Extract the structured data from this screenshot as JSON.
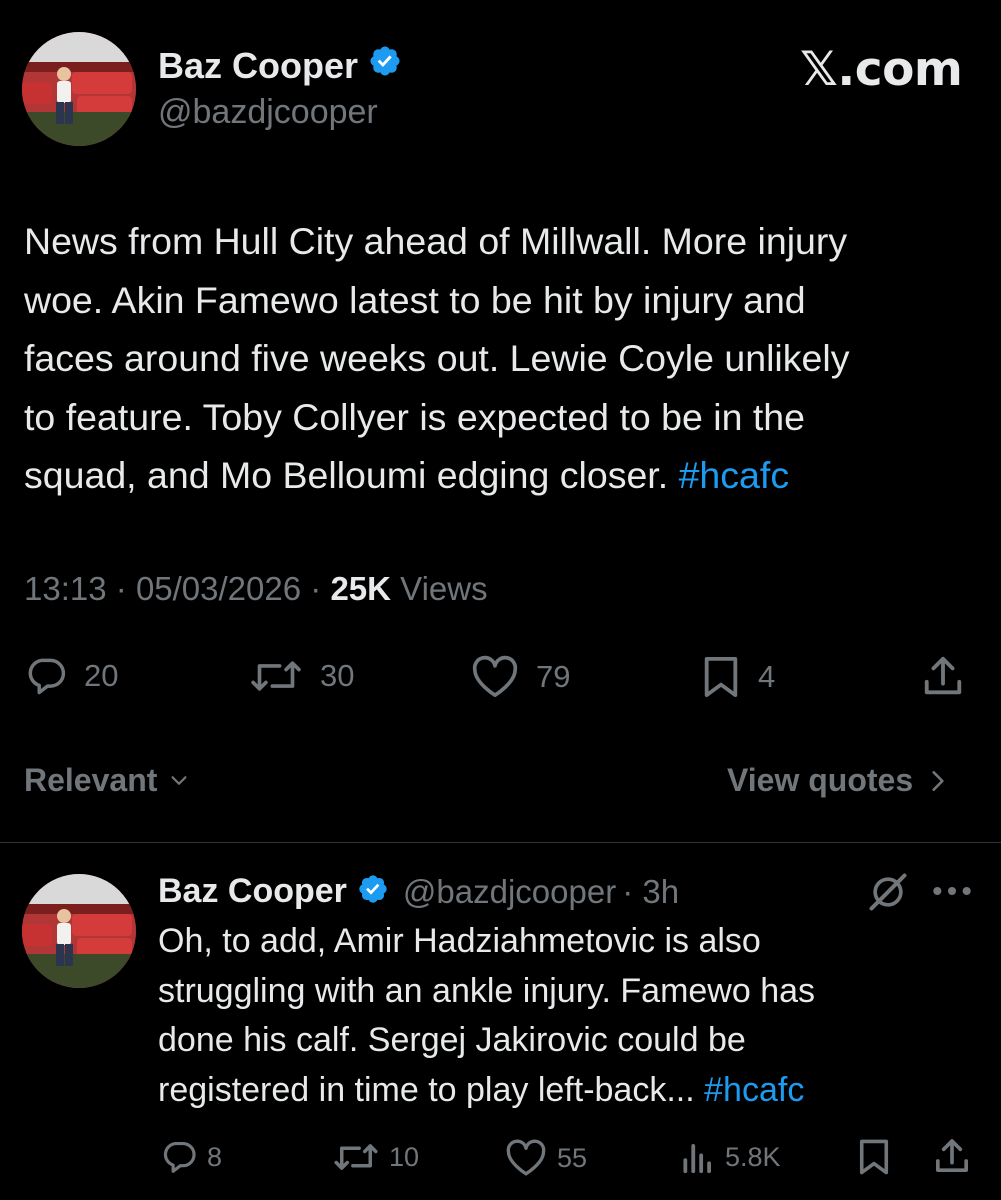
{
  "brand": "𝕏.com",
  "main_tweet": {
    "author_name": "Baz Cooper",
    "handle": "@bazdjcooper",
    "text_lines": [
      "News from Hull City ahead of Millwall. More injury",
      "woe. Akin Famewo latest to be hit by injury and",
      "faces around five weeks out. Lewie Coyle unlikely",
      "to feature. Toby Collyer is expected to be in the",
      "squad, and Mo Belloumi edging closer."
    ],
    "hashtag": "#hcafc",
    "time": "13:13",
    "date": "05/03/2026",
    "views_count": "25K",
    "views_label": "Views",
    "separator": "·",
    "stats": {
      "replies": "20",
      "reposts": "30",
      "likes": "79",
      "bookmarks": "4"
    }
  },
  "sort": {
    "relevant_label": "Relevant",
    "view_quotes_label": "View quotes"
  },
  "reply_tweet": {
    "author_name": "Baz Cooper",
    "handle": "@bazdjcooper",
    "age": "· 3h",
    "text_lines": [
      "Oh, to add, Amir Hadziahmetovic is also",
      "struggling with an ankle injury. Famewo has",
      "done his calf. Sergej Jakirovic could be",
      "registered in time to play left-back..."
    ],
    "hashtag": "#hcafc",
    "stats": {
      "replies": "8",
      "reposts": "10",
      "likes": "55",
      "views": "5.8K"
    }
  },
  "colors": {
    "background": "#000000",
    "text": "#e7e9ea",
    "muted": "#71767b",
    "link": "#1d9bf0",
    "verified": "#1d9bf0"
  }
}
